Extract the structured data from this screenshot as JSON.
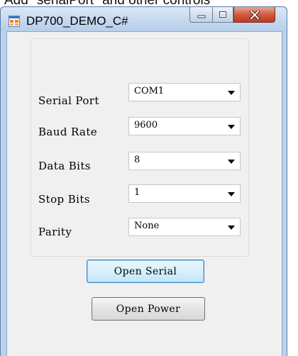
{
  "caption_strip": "Add \"serialPort\" and other controls",
  "window": {
    "title": "DP700_DEMO_C#",
    "app_icon": "windows-form-icon",
    "controls": {
      "minimize_icon": "minimize-icon",
      "maximize_icon": "maximize-icon",
      "close_icon": "close-icon"
    }
  },
  "form": {
    "rows": [
      {
        "label": "Serial Port",
        "value": "COM1"
      },
      {
        "label": "Baud Rate",
        "value": "9600"
      },
      {
        "label": "Data Bits",
        "value": "8"
      },
      {
        "label": "Stop Bits",
        "value": "1"
      },
      {
        "label": "Parity",
        "value": "None"
      }
    ],
    "open_serial_label": "Open Serial",
    "open_power_label": "Open Power"
  },
  "colors": {
    "client_background": "#f0f0f0",
    "close_button": "#c8462b",
    "titlebar": "#c3d7ee"
  }
}
